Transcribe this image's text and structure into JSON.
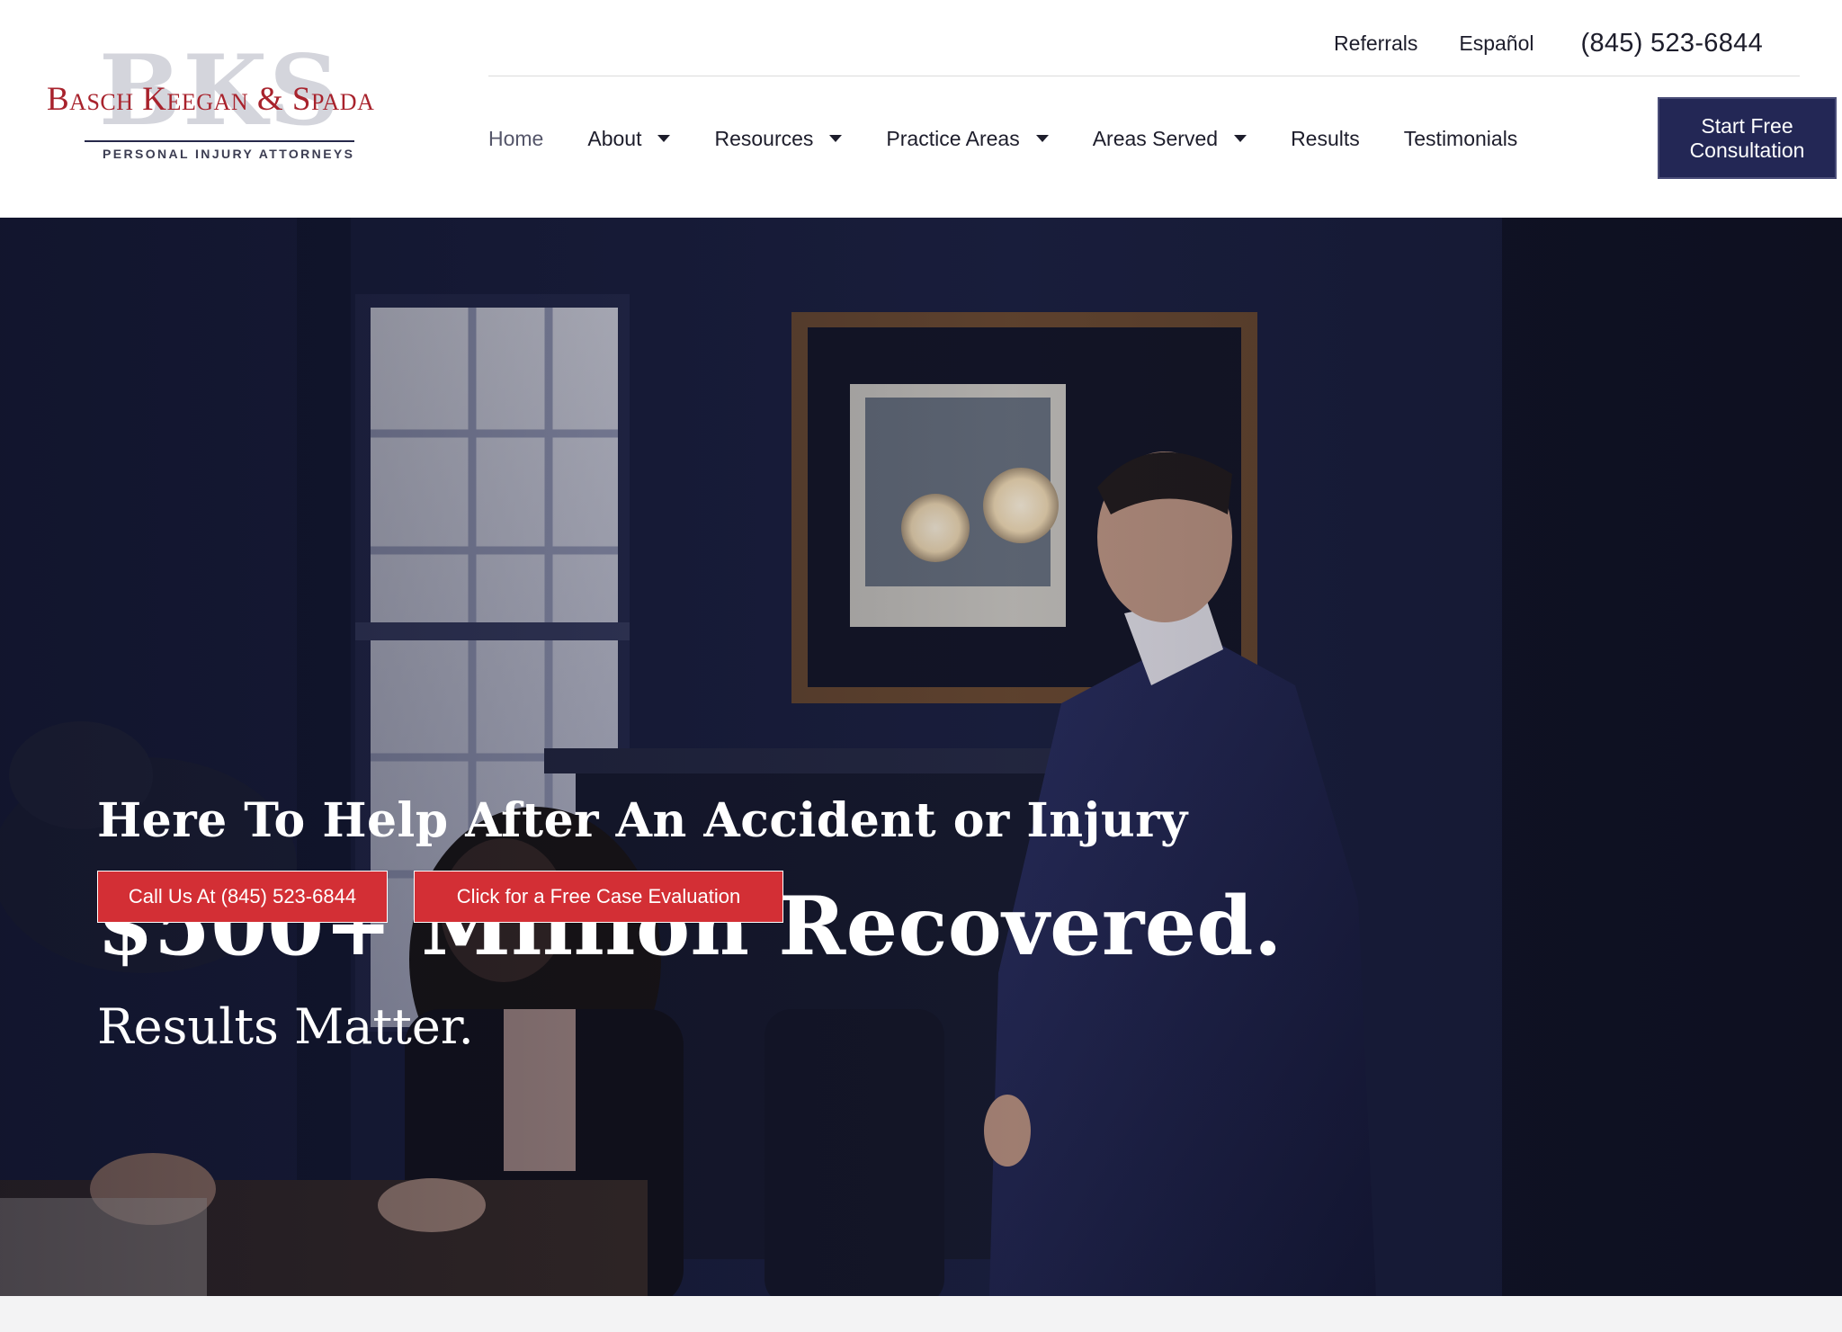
{
  "brand": {
    "monogram": "BKS",
    "name": "Basch Keegan & Spada",
    "tagline": "PERSONAL INJURY ATTORNEYS"
  },
  "topbar": {
    "links": [
      "Referrals",
      "Español"
    ],
    "phone": "(845) 523-6844"
  },
  "nav": {
    "items": [
      {
        "label": "Home",
        "has_dropdown": false,
        "active": true
      },
      {
        "label": "About",
        "has_dropdown": true
      },
      {
        "label": "Resources",
        "has_dropdown": true
      },
      {
        "label": "Practice Areas",
        "has_dropdown": true
      },
      {
        "label": "Areas Served",
        "has_dropdown": true
      },
      {
        "label": "Results",
        "has_dropdown": false
      },
      {
        "label": "Testimonials",
        "has_dropdown": false
      }
    ],
    "cta_label": "Start Free Consultation"
  },
  "hero": {
    "kicker": "Here To Help After An Accident or Injury",
    "title": "$500+ Million Recovered.",
    "subtitle": "Results Matter.",
    "buttons": {
      "call": "Call Us At (845) 523-6844",
      "evaluation": "Click for a Free Case Evaluation"
    }
  },
  "colors": {
    "brand_red": "#a8222c",
    "button_red": "#d32f35",
    "navy": "#232755"
  }
}
